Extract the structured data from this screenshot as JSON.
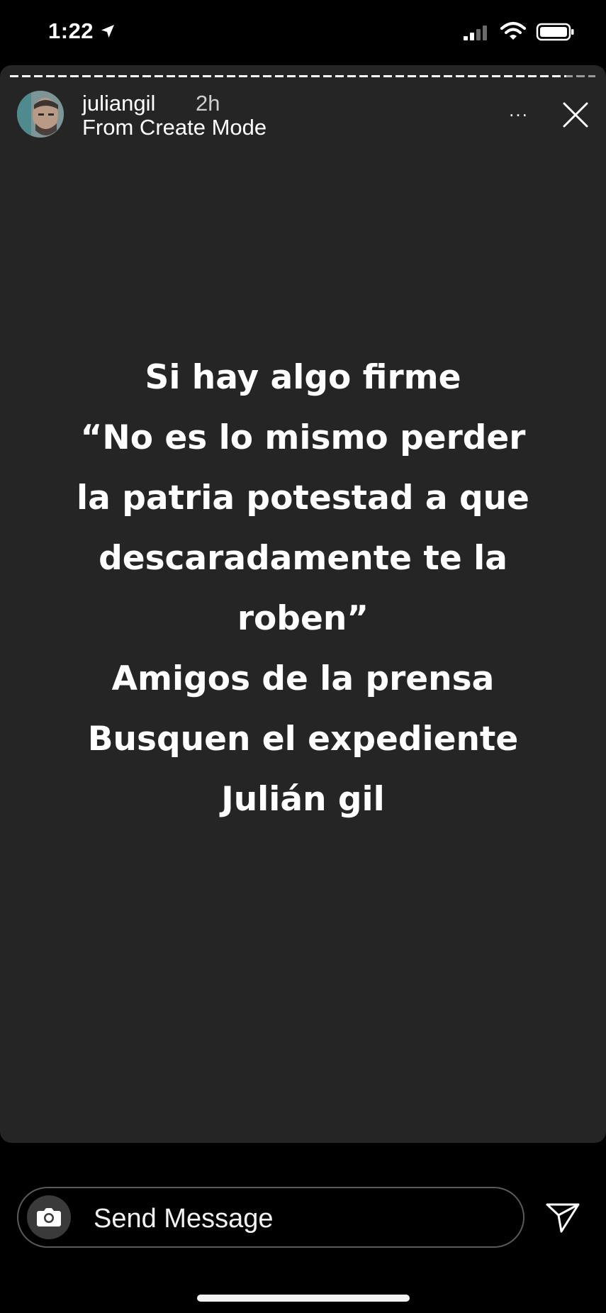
{
  "status_bar": {
    "time": "1:22"
  },
  "story": {
    "progress": 0.95,
    "username": "juliangil",
    "timestamp": "2h",
    "subtitle": "From Create Mode",
    "more_label": "...",
    "text_lines": [
      "Si hay algo firme",
      "“No es lo mismo perder",
      "la patria potestad a que",
      "descaradamente te la",
      "roben”",
      "Amigos de la prensa",
      "Busquen el expediente",
      "Julián gil"
    ]
  },
  "message_bar": {
    "placeholder": "Send Message"
  },
  "icons": {
    "location": "location-arrow-icon",
    "signal": "cellular-signal-icon",
    "wifi": "wifi-icon",
    "battery": "battery-icon",
    "close": "close-icon",
    "camera": "camera-icon",
    "send": "paper-plane-icon"
  },
  "colors": {
    "background": "#000000",
    "card": "#252525",
    "text": "#ffffff"
  }
}
